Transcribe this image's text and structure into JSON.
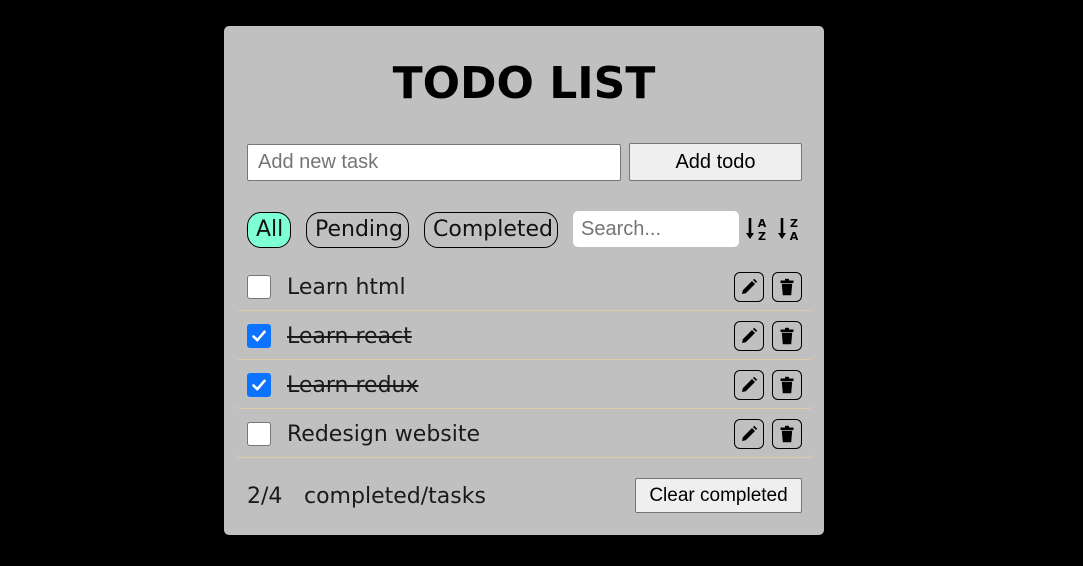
{
  "app": {
    "title": "TODO LIST"
  },
  "new_task": {
    "placeholder": "Add new task",
    "value": "",
    "add_label": "Add todo"
  },
  "filters": [
    {
      "label": "All",
      "active": true
    },
    {
      "label": "Pending",
      "active": false
    },
    {
      "label": "Completed",
      "active": false
    }
  ],
  "search": {
    "placeholder": "Search...",
    "value": ""
  },
  "sort": {
    "ascending_icon": "sort-alpha-down-icon",
    "descending_icon": "sort-alpha-up-icon"
  },
  "todos": [
    {
      "text": "Learn html",
      "completed": false
    },
    {
      "text": "Learn react",
      "completed": true
    },
    {
      "text": "Learn redux",
      "completed": true
    },
    {
      "text": "Redesign website",
      "completed": false
    }
  ],
  "footer": {
    "count": "2/4",
    "count_label": "completed/tasks",
    "clear_label": "Clear completed"
  },
  "colors": {
    "page_background": "#000000",
    "card_background": "#c0c0c0",
    "active_filter": "#7fffd4",
    "checkbox_checked": "#0b73ff",
    "row_divider": "#e2c9a8"
  }
}
